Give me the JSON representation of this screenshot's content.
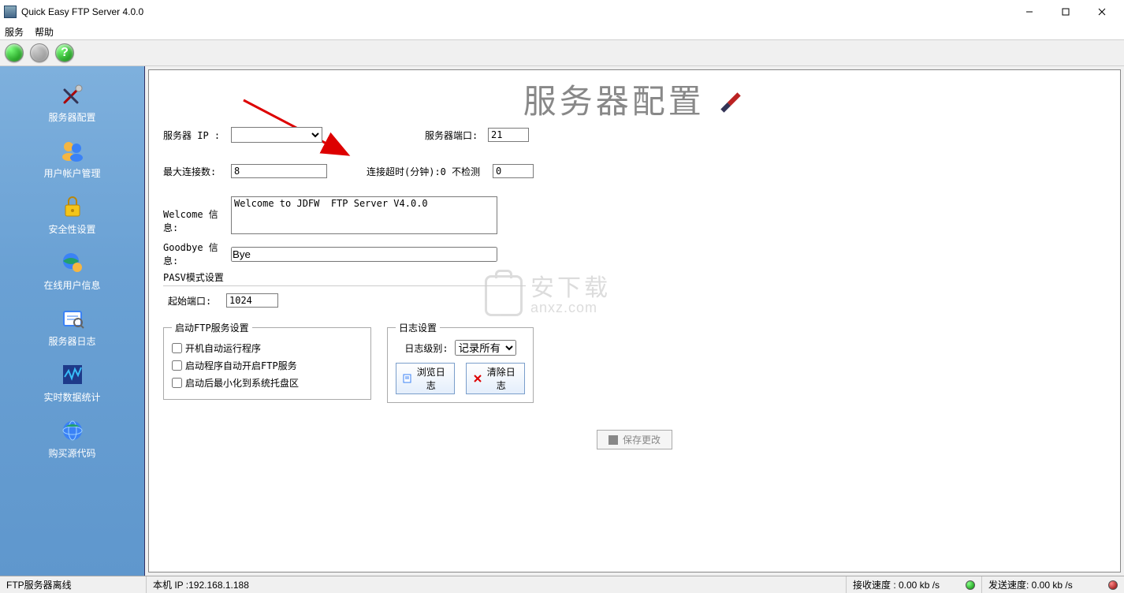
{
  "window": {
    "title": "Quick Easy FTP Server 4.0.0"
  },
  "menu": {
    "service": "服务",
    "help": "帮助"
  },
  "sidebar": {
    "items": [
      {
        "label": "服务器配置"
      },
      {
        "label": "用户帐户管理"
      },
      {
        "label": "安全性设置"
      },
      {
        "label": "在线用户信息"
      },
      {
        "label": "服务器日志"
      },
      {
        "label": "实时数据统计"
      },
      {
        "label": "购买源代码"
      }
    ]
  },
  "page": {
    "title": "服务器配置",
    "server_ip_label": "服务器 IP :",
    "server_ip_value": "",
    "server_port_label": "服务器端口:",
    "server_port_value": "21",
    "max_conn_label": "最大连接数:",
    "max_conn_value": "8",
    "timeout_label": "连接超时(分钟):0 不检测",
    "timeout_value": "0",
    "welcome_label": "Welcome 信息:",
    "welcome_value": "Welcome to JDFW  FTP Server V4.0.0",
    "goodbye_label": "Goodbye 信息:",
    "goodbye_value": "Bye",
    "pasv_label": "PASV模式设置",
    "pasv_start_port_label": "起始端口:",
    "pasv_start_port_value": "1024",
    "startup_group": "启动FTP服务设置",
    "startup_opts": [
      "开机自动运行程序",
      "启动程序自动开启FTP服务",
      "启动后最小化到系统托盘区"
    ],
    "log_group": "日志设置",
    "log_level_label": "日志级别:",
    "log_level_value": "记录所有",
    "browse_log": "浏览日志",
    "clear_log": "清除日志",
    "save": "保存更改"
  },
  "watermark": {
    "cn": "安下载",
    "en": "anxz.com"
  },
  "status": {
    "server_state": "FTP服务器离线",
    "local_ip": "本机 IP :192.168.1.188",
    "recv": "接收速度 : 0.00   kb /s",
    "send": "发送速度:  0.00   kb /s"
  }
}
